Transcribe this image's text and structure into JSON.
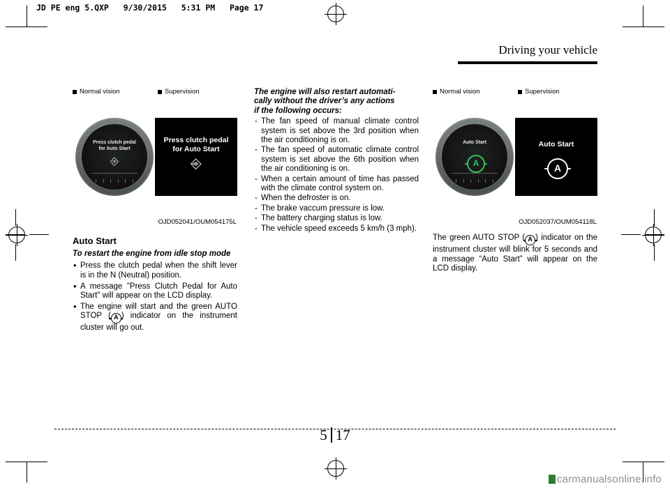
{
  "header": {
    "file_line": "JD PE eng 5.QXP   9/30/2015   5:31 PM   Page 17",
    "section_title": "Driving your vehicle"
  },
  "figures": {
    "fig1": {
      "legend_normal": "Normal vision",
      "legend_supervision": "Supervision",
      "cluster_text_line1": "Press clutch pedal",
      "cluster_text_line2": "for Auto Start",
      "lcd_text_line1": "Press clutch pedal",
      "lcd_text_line2": "for Auto Start",
      "icon": "clutch-pedal-icon",
      "caption": "OJD052041/OUM054175L"
    },
    "fig2": {
      "legend_normal": "Normal vision",
      "legend_supervision": "Supervision",
      "cluster_text": "Auto Start",
      "lcd_text": "Auto Start",
      "symbol": "A",
      "caption": "OJD052037/OUM054118L"
    }
  },
  "col1": {
    "heading": "Auto Start",
    "subhead": "To restart the engine from idle stop mode",
    "bullets": [
      "Press the clutch pedal when the shift lever is in the N (Neutral) position.",
      "A message \"Press Clutch Pedal for Auto Start\" will appear on the LCD display."
    ],
    "bullet3_part1": "The engine will start and the green AUTO STOP (",
    "bullet3_symbol": "A",
    "bullet3_part2": ") indicator on the instrument cluster will go out."
  },
  "col2": {
    "intro_line1": "The engine will also restart automati-",
    "intro_line2": "cally without the driver’s any actions",
    "intro_line3": "if the following occurs:",
    "items": [
      "The fan speed of manual climate control system is set above the 3rd position when the air conditioning is on.",
      "The fan speed of automatic climate control system is set above the 6th position when the air conditioning is on.",
      "When a certain amount of time has passed with the climate control system on.",
      "When the defroster is on.",
      "The brake vaccum pressure is low.",
      "The battery charging status is low.",
      "The vehicle speed exceeds 5 km/h (3 mph)."
    ]
  },
  "col3": {
    "para_part1": "The green AUTO STOP (",
    "para_symbol": "A",
    "para_part2": ") indicator on the instrument cluster will blink for 5 seconds and a message “Auto Start” will appear on the LCD display."
  },
  "footer": {
    "chapter": "5",
    "page": "17",
    "watermark": "carmanualsonline.info"
  }
}
